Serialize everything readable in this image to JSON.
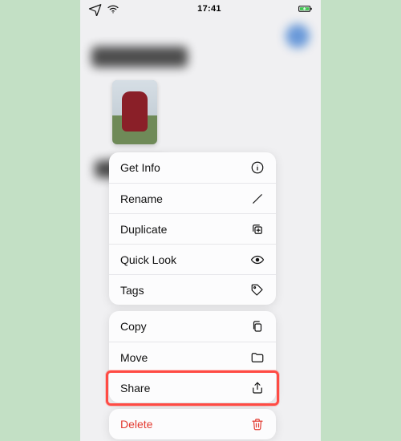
{
  "status": {
    "time": "17:41"
  },
  "menu": {
    "group1": {
      "getinfo": {
        "label": "Get Info"
      },
      "rename": {
        "label": "Rename"
      },
      "duplicate": {
        "label": "Duplicate"
      },
      "quicklook": {
        "label": "Quick Look"
      },
      "tags": {
        "label": "Tags"
      }
    },
    "group2": {
      "copy": {
        "label": "Copy"
      },
      "move": {
        "label": "Move"
      },
      "share": {
        "label": "Share"
      }
    },
    "group3": {
      "delete": {
        "label": "Delete"
      }
    }
  },
  "highlight": {
    "target": "share"
  }
}
